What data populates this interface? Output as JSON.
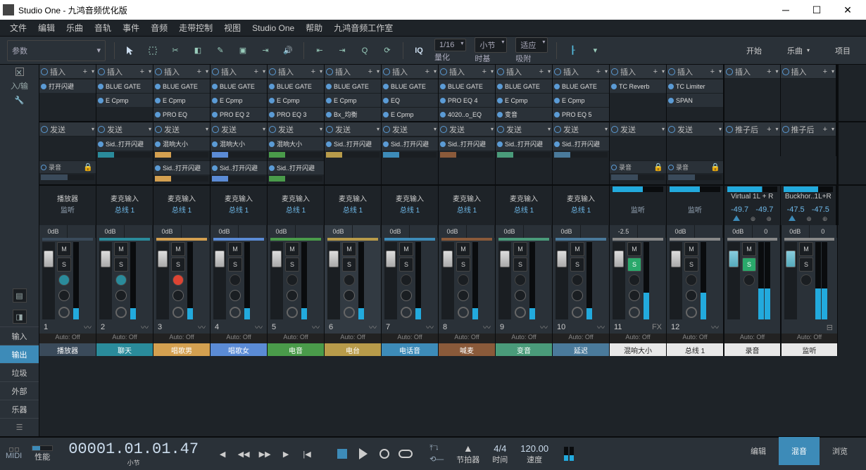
{
  "title": "Studio One - 九鸿音频优化版",
  "menu": [
    "文件",
    "编辑",
    "乐曲",
    "音轨",
    "事件",
    "音频",
    "走带控制",
    "视图",
    "Studio One",
    "帮助",
    "九鸿音频工作室"
  ],
  "toolbar": {
    "param": "参数",
    "iq": "IQ",
    "quant": {
      "val": "1/16",
      "lbl": "量化"
    },
    "timebase": {
      "val": "小节",
      "lbl": "时基"
    },
    "snap": {
      "val": "适应",
      "lbl": "吸附"
    },
    "tabs": [
      "开始",
      "乐曲",
      "项目"
    ]
  },
  "left": {
    "io": "入/输",
    "nav": [
      "输入",
      "输出",
      "垃圾",
      "外部",
      "乐器"
    ],
    "active": "输出"
  },
  "insert_hdr": "插入",
  "send_hdr": "发送",
  "rec_hdr": "录音",
  "post_hdr": "推子后",
  "channels": [
    {
      "name": "播放器",
      "bus": "监听",
      "busColor": "#3a4a5a",
      "inserts": [
        "打开闪避"
      ],
      "sends": [],
      "rec": true,
      "gain": "0dB",
      "pan": "<C>",
      "num": "1",
      "label": "播放器",
      "labelColor": "#3a4a5a",
      "accent": "#3a4a5a",
      "solo": false,
      "mon": "teal",
      "rec2": false
    },
    {
      "name": "麦克输入",
      "bus": "总线 1",
      "busColor": "#3d8bb8",
      "inserts": [
        "BLUE GATE",
        "E Cpmp"
      ],
      "sends": [
        "Sid..打开闪避"
      ],
      "rec": false,
      "gain": "0dB",
      "pan": "<C>",
      "num": "2",
      "label": "聊天",
      "labelColor": "#2a8b9b",
      "accent": "#2a8b9b",
      "solo": false,
      "mon": "teal",
      "rec2": false
    },
    {
      "name": "麦克输入",
      "bus": "总线 1",
      "busColor": "#3d8bb8",
      "inserts": [
        "BLUE GATE",
        "E Cpmp",
        "PRO EQ"
      ],
      "sends": [
        "混响大小"
      ],
      "sends2": [
        "Sid..打开闪避"
      ],
      "rec": false,
      "gain": "0dB",
      "pan": "<C>",
      "num": "3",
      "label": "唱歌男",
      "labelColor": "#d4a050",
      "accent": "#d4a050",
      "solo": false,
      "mon": "red",
      "rec2": true
    },
    {
      "name": "麦克输入",
      "bus": "总线 1",
      "busColor": "#3d8bb8",
      "inserts": [
        "BLUE GATE",
        "E Cpmp",
        "PRO EQ 2"
      ],
      "sends": [
        "混响大小"
      ],
      "sends2": [
        "Sid..打开闪避"
      ],
      "rec": false,
      "gain": "0dB",
      "pan": "<C>",
      "num": "4",
      "label": "唱歌女",
      "labelColor": "#5b8bd5",
      "accent": "#5b8bd5",
      "solo": false,
      "mon": "",
      "rec2": false
    },
    {
      "name": "麦克输入",
      "bus": "总线 1",
      "busColor": "#3d8bb8",
      "inserts": [
        "BLUE GATE",
        "E Cpmp",
        "PRO EQ 3"
      ],
      "sends": [
        "混响大小"
      ],
      "sends2": [
        "Sid..打开闪避"
      ],
      "rec": false,
      "gain": "0dB",
      "pan": "<C>",
      "num": "5",
      "label": "电音",
      "labelColor": "#4a9b4a",
      "accent": "#4a9b4a",
      "solo": false,
      "mon": "",
      "rec2": false
    },
    {
      "name": "麦克输入",
      "bus": "总线 1",
      "busColor": "#3d8bb8",
      "inserts": [
        "BLUE GATE",
        "E Cpmp",
        "Bx_均衡"
      ],
      "sends": [
        "Sid..打开闪避"
      ],
      "rec": false,
      "gain": "0dB",
      "pan": "<C>",
      "num": "6",
      "label": "电台",
      "labelColor": "#b89b4a",
      "accent": "#b89b4a",
      "solo": false,
      "mon": "",
      "rec2": false,
      "highlighted": true
    },
    {
      "name": "麦克输入",
      "bus": "总线 1",
      "busColor": "#3d8bb8",
      "inserts": [
        "BLUE GATE",
        "EQ",
        "E Cpmp"
      ],
      "sends": [
        "Sid..打开闪避"
      ],
      "rec": false,
      "gain": "0dB",
      "pan": "<C>",
      "num": "7",
      "label": "电话音",
      "labelColor": "#3d8bb8",
      "accent": "#3d8bb8",
      "solo": false,
      "mon": "",
      "rec2": false
    },
    {
      "name": "麦克输入",
      "bus": "总线 1",
      "busColor": "#3d8bb8",
      "inserts": [
        "BLUE GATE",
        "PRO EQ 4",
        "4020..o_EQ"
      ],
      "sends": [
        "Sid..打开闪避"
      ],
      "rec": false,
      "gain": "0dB",
      "pan": "<C>",
      "num": "8",
      "label": "喊麦",
      "labelColor": "#8a5a3a",
      "accent": "#8a5a3a",
      "solo": false,
      "mon": "",
      "rec2": false
    },
    {
      "name": "麦克输入",
      "bus": "总线 1",
      "busColor": "#3d8bb8",
      "inserts": [
        "BLUE GATE",
        "E Cpmp",
        "变音"
      ],
      "sends": [
        "Sid..打开闪避"
      ],
      "rec": false,
      "gain": "0dB",
      "pan": "<C>",
      "num": "9",
      "label": "变音",
      "labelColor": "#4a9b7a",
      "accent": "#4a9b7a",
      "solo": false,
      "mon": "",
      "rec2": false
    },
    {
      "name": "麦克输入",
      "bus": "总线 1",
      "busColor": "#3d8bb8",
      "inserts": [
        "BLUE GATE",
        "E Cpmp",
        "PRO EQ 5"
      ],
      "sends": [
        "Sid..打开闪避"
      ],
      "rec": false,
      "gain": "0dB",
      "pan": "<C>",
      "num": "10",
      "label": "延迟",
      "labelColor": "#4a7a9b",
      "accent": "#4a7a9b",
      "solo": false,
      "mon": "",
      "rec2": false
    },
    {
      "name": "",
      "bus": "监听",
      "busColor": "#3a4a5a",
      "inserts": [
        "TC Reverb"
      ],
      "sends": [],
      "rec": true,
      "gain": "-2.5",
      "pan": "<C>",
      "num": "11",
      "numExtra": "FX",
      "label": "混响大小",
      "labelColor": "#e8e8e8",
      "labelTextColor": "#222",
      "accent": "#888",
      "solo": "green",
      "mon": "",
      "rec2": false
    },
    {
      "name": "",
      "bus": "监听",
      "busColor": "#3a4a5a",
      "inserts": [
        "TC Limiter",
        "SPAN"
      ],
      "sends": [],
      "rec": true,
      "gain": "0dB",
      "pan": "<C>",
      "num": "12",
      "label": "总线 1",
      "labelColor": "#e8e8e8",
      "labelTextColor": "#222",
      "accent": "#888",
      "solo": false,
      "mon": "",
      "rec2": false
    }
  ],
  "masters": [
    {
      "name": "Virtual 1L + R",
      "db": [
        "-49.7",
        "-49.7"
      ],
      "bus": "",
      "gain": "0dB",
      "pan": "0",
      "num": "",
      "label": "录音",
      "labelColor": "#e8e8e8",
      "labelTextColor": "#222",
      "solo": "green"
    },
    {
      "name": "Buckhor..1L+R",
      "db": [
        "-47.5",
        "-47.5"
      ],
      "bus": "",
      "gain": "0dB",
      "pan": "0",
      "num": "",
      "label": "监听",
      "labelColor": "#e8e8e8",
      "labelTextColor": "#222",
      "solo": false
    }
  ],
  "auto_off": "Auto: Off",
  "transport": {
    "midi": "MIDI",
    "perf": "性能",
    "tc": "00001.01.01.47",
    "tc_lbl": "小节",
    "metro": "节拍器",
    "sig": "4/4",
    "sig_lbl": "时间",
    "tempo": "120.00",
    "tempo_lbl": "速度",
    "tabs": [
      "编辑",
      "混音",
      "浏览"
    ],
    "active": "混音"
  }
}
